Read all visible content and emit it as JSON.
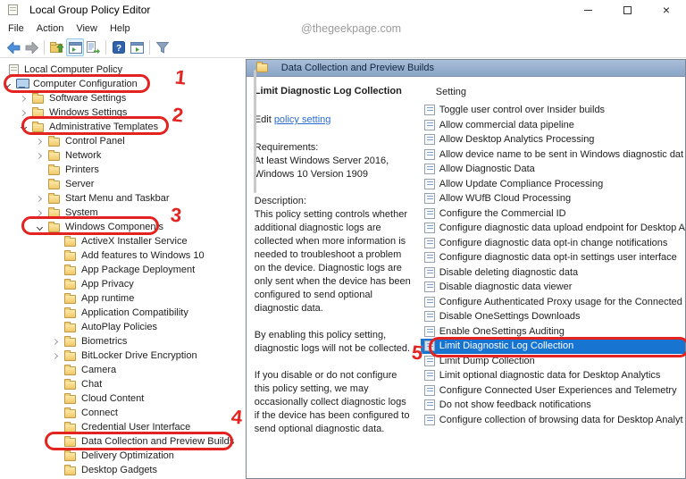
{
  "window": {
    "title": "Local Group Policy Editor",
    "watermark": "@thegeekpage.com",
    "close_glyph": "×"
  },
  "menu": {
    "items": [
      "File",
      "Action",
      "View",
      "Help"
    ]
  },
  "toolbar": {
    "icons": [
      "back-arrow",
      "forward-arrow",
      "up-folder",
      "show-console-tree",
      "export-list",
      "help",
      "show-action-pane",
      "filter"
    ]
  },
  "tree": {
    "items": [
      {
        "label": "Local Computer Policy",
        "depth": 0,
        "expand": "none",
        "icon": "scroll"
      },
      {
        "label": "Computer Configuration",
        "depth": 1,
        "expand": "expanded",
        "icon": "computer"
      },
      {
        "label": "Software Settings",
        "depth": 2,
        "expand": "collapsed",
        "icon": "folder"
      },
      {
        "label": "Windows Settings",
        "depth": 2,
        "expand": "collapsed",
        "icon": "folder"
      },
      {
        "label": "Administrative Templates",
        "depth": 2,
        "expand": "expanded",
        "icon": "folder"
      },
      {
        "label": "Control Panel",
        "depth": 3,
        "expand": "collapsed",
        "icon": "folder"
      },
      {
        "label": "Network",
        "depth": 3,
        "expand": "collapsed",
        "icon": "folder"
      },
      {
        "label": "Printers",
        "depth": 3,
        "expand": "none",
        "icon": "folder"
      },
      {
        "label": "Server",
        "depth": 3,
        "expand": "none",
        "icon": "folder"
      },
      {
        "label": "Start Menu and Taskbar",
        "depth": 3,
        "expand": "collapsed",
        "icon": "folder"
      },
      {
        "label": "System",
        "depth": 3,
        "expand": "collapsed",
        "icon": "folder"
      },
      {
        "label": "Windows Components",
        "depth": 3,
        "expand": "expanded",
        "icon": "folder"
      },
      {
        "label": "ActiveX Installer Service",
        "depth": 4,
        "expand": "none",
        "icon": "folder"
      },
      {
        "label": "Add features to Windows 10",
        "depth": 4,
        "expand": "none",
        "icon": "folder"
      },
      {
        "label": "App Package Deployment",
        "depth": 4,
        "expand": "none",
        "icon": "folder"
      },
      {
        "label": "App Privacy",
        "depth": 4,
        "expand": "none",
        "icon": "folder"
      },
      {
        "label": "App runtime",
        "depth": 4,
        "expand": "none",
        "icon": "folder"
      },
      {
        "label": "Application Compatibility",
        "depth": 4,
        "expand": "none",
        "icon": "folder"
      },
      {
        "label": "AutoPlay Policies",
        "depth": 4,
        "expand": "none",
        "icon": "folder"
      },
      {
        "label": "Biometrics",
        "depth": 4,
        "expand": "collapsed",
        "icon": "folder"
      },
      {
        "label": "BitLocker Drive Encryption",
        "depth": 4,
        "expand": "collapsed",
        "icon": "folder"
      },
      {
        "label": "Camera",
        "depth": 4,
        "expand": "none",
        "icon": "folder"
      },
      {
        "label": "Chat",
        "depth": 4,
        "expand": "none",
        "icon": "folder"
      },
      {
        "label": "Cloud Content",
        "depth": 4,
        "expand": "none",
        "icon": "folder"
      },
      {
        "label": "Connect",
        "depth": 4,
        "expand": "none",
        "icon": "folder"
      },
      {
        "label": "Credential User Interface",
        "depth": 4,
        "expand": "none",
        "icon": "folder"
      },
      {
        "label": "Data Collection and Preview Builds",
        "depth": 4,
        "expand": "none",
        "icon": "folder"
      },
      {
        "label": "Delivery Optimization",
        "depth": 4,
        "expand": "none",
        "icon": "folder"
      },
      {
        "label": "Desktop Gadgets",
        "depth": 4,
        "expand": "none",
        "icon": "folder"
      }
    ]
  },
  "middle": {
    "header": "Data Collection and Preview Builds",
    "policy_title": "Limit Diagnostic Log Collection",
    "edit_prefix": "Edit ",
    "edit_link": "policy setting",
    "requirements_label": "Requirements:",
    "requirements_text": "At least Windows Server 2016, Windows 10 Version 1909",
    "description_label": "Description:",
    "paragraphs": [
      "This policy setting controls whether additional diagnostic logs are collected when more information is needed to troubleshoot a problem on the device. Diagnostic logs are only sent when the device has been configured to send optional diagnostic data.",
      "By enabling this policy setting, diagnostic logs will not be collected.",
      "If you disable or do not configure this policy setting, we may occasionally collect diagnostic logs if the device has been configured to send optional diagnostic data."
    ]
  },
  "settings": {
    "column_header": "Setting",
    "selected_index": 16,
    "items": [
      "Toggle user control over Insider builds",
      "Allow commercial data pipeline",
      "Allow Desktop Analytics Processing",
      "Allow device name to be sent in Windows diagnostic dat",
      "Allow Diagnostic Data",
      "Allow Update Compliance Processing",
      "Allow WUfB Cloud Processing",
      "Configure the Commercial ID",
      "Configure diagnostic data upload endpoint for Desktop A",
      "Configure diagnostic data opt-in change notifications",
      "Configure diagnostic data opt-in settings user interface",
      "Disable deleting diagnostic data",
      "Disable diagnostic data viewer",
      "Configure Authenticated Proxy usage for the Connected",
      "Disable OneSettings Downloads",
      "Enable OneSettings Auditing",
      "Limit Diagnostic Log Collection",
      "Limit Dump Collection",
      "Limit optional diagnostic data for Desktop Analytics",
      "Configure Connected User Experiences and Telemetry",
      "Do not show feedback notifications",
      "Configure collection of browsing data for Desktop Analyt"
    ]
  },
  "annotations": {
    "labels": [
      "1",
      "2",
      "3",
      "4",
      "5"
    ]
  },
  "colors": {
    "selection_blue": "#1774d1",
    "annotation_red": "#e42320",
    "panel_header_blue": "#8aa5c7",
    "link_blue": "#2b6cd4"
  }
}
